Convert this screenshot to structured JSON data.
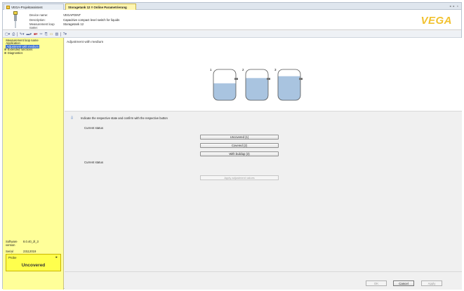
{
  "tabs": [
    {
      "label": "VEGA-Projektassistent"
    },
    {
      "label": "Storagetank 12 # Online Parametrierung"
    }
  ],
  "window_controls": "◂ ▸ ×",
  "header": {
    "device_name_label": "Device name:",
    "device_name": "VEGAPOINT",
    "description_label": "Description:",
    "description": "Capacitive compact level switch for liquids",
    "loop_name_label": "Measurement loop name:",
    "loop_name": "Storagetank 12",
    "logo": "VEGA"
  },
  "toolbar_icons": [
    "device-icon",
    "print-icon",
    "tools-icon",
    "display-icon",
    "record-icon",
    "cut-icon",
    "copy-icon",
    "open-icon",
    "image-icon",
    "help-icon"
  ],
  "sidebar": {
    "tree": [
      {
        "label": "Measurement loop name",
        "prefix": ""
      },
      {
        "label": "Application",
        "prefix": ""
      },
      {
        "label": "Adjustment with medium",
        "prefix": ""
      },
      {
        "label": "Extended functions",
        "prefix": "⊞"
      },
      {
        "label": "Diagnostics",
        "prefix": "⊞"
      }
    ],
    "info": {
      "software_label": "Software version",
      "software": "8.0.40_2l_3",
      "serial_label": "Serial number",
      "serial": "23112019",
      "status_label": "Device status",
      "status": "OK"
    },
    "probe": {
      "label": "Probe",
      "value": "Uncovered"
    }
  },
  "main": {
    "title": "Adjustment with medium",
    "tank_labels": [
      "1",
      "2",
      "3"
    ],
    "tank_fill_levels": [
      0.55,
      0.72,
      0.78
    ],
    "colors": {
      "liquid": "#a9c4e0",
      "tank_outline": "#555555"
    },
    "hint": "Indicate the respective state and confirm with the respective button",
    "current_status_1": "Current status",
    "buttons": {
      "uncovered": "Uncovered (1)",
      "covered": "Covered (2)",
      "buildup": "With buildup (3)"
    },
    "current_status_2": "Current status",
    "apply_adjustment": "Apply adjustment values"
  },
  "footer": {
    "ok": "OK",
    "cancel": "Cancel",
    "apply": "Apply"
  }
}
